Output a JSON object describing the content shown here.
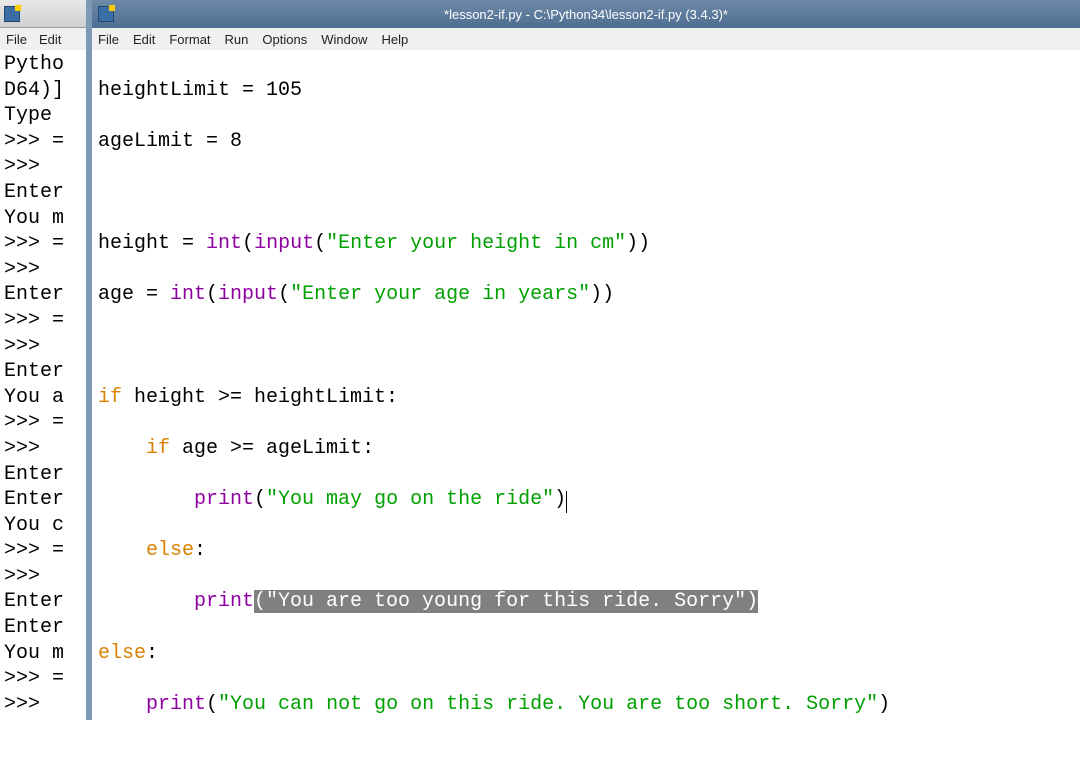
{
  "shell": {
    "menus": {
      "file": "File",
      "edit": "Edit"
    },
    "lines": [
      "Pytho",
      "D64)]",
      "Type ",
      ">>> =",
      ">>> ",
      "Enter",
      "You m",
      ">>> =",
      ">>> ",
      "Enter",
      ">>> =",
      ">>> ",
      "Enter",
      "You a",
      ">>> =",
      ">>> ",
      "Enter",
      "Enter",
      "You c",
      ">>> =",
      ">>> ",
      "Enter",
      "Enter",
      "You m",
      ">>> =",
      ">>> "
    ]
  },
  "editor": {
    "title": "*lesson2-if.py - C:\\Python34\\lesson2-if.py (3.4.3)*",
    "menus": {
      "file": "File",
      "edit": "Edit",
      "format": "Format",
      "run": "Run",
      "options": "Options",
      "window": "Window",
      "help": "Help"
    },
    "code": {
      "l1_a": "heightLimit = 105",
      "l2_a": "ageLimit = 8",
      "l3_a": "",
      "l4_a": "height = ",
      "l4_b": "int",
      "l4_c": "(",
      "l4_d": "input",
      "l4_e": "(",
      "l4_f": "\"Enter your height in cm\"",
      "l4_g": "))",
      "l5_a": "age = ",
      "l5_b": "int",
      "l5_c": "(",
      "l5_d": "input",
      "l5_e": "(",
      "l5_f": "\"Enter your age in years\"",
      "l5_g": "))",
      "l6_a": "",
      "l7_kw": "if",
      "l7_a": " height >= heightLimit:",
      "l8_pad": "    ",
      "l8_kw": "if",
      "l8_a": " age >= ageLimit:",
      "l9_pad": "        ",
      "l9_b": "print",
      "l9_c": "(",
      "l9_d": "\"You may go on the ride\"",
      "l9_e": ")",
      "l10_pad": "    ",
      "l10_kw": "else",
      "l10_a": ":",
      "l11_pad": "        ",
      "l11_b": "print",
      "l11_sel": "(\"You are too young for this ride. Sorry\")",
      "l12_kw": "else",
      "l12_a": ":",
      "l13_pad": "    ",
      "l13_b": "print",
      "l13_c": "(",
      "l13_d": "\"You can not go on this ride. You are too short. Sorry\"",
      "l13_e": ")"
    }
  }
}
